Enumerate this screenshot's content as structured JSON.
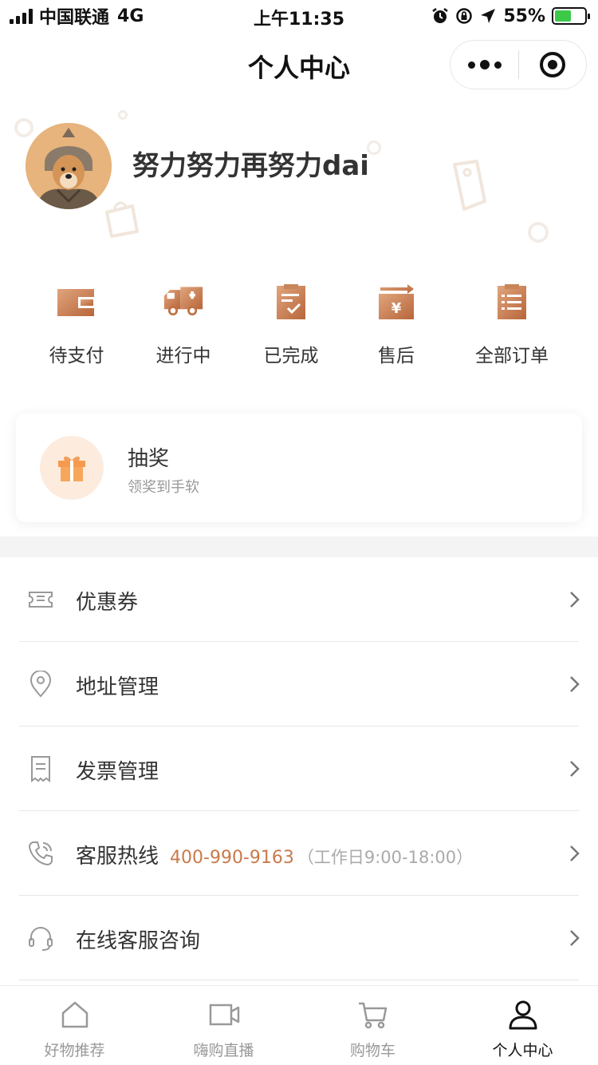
{
  "status_bar": {
    "carrier": "中国联通",
    "network": "4G",
    "time": "上午11:35",
    "battery": "55%",
    "battery_level": 0.55,
    "icons": [
      "signal-icon",
      "alarm-icon",
      "rotation-lock-icon",
      "location-arrow-icon",
      "battery-icon"
    ]
  },
  "nav": {
    "title": "个人中心",
    "capsule_icons": [
      "more-dots-icon",
      "close-target-icon"
    ]
  },
  "profile": {
    "username": "努力努力再努力dai",
    "avatar_icon": "dog-avatar"
  },
  "orders": [
    {
      "label": "待支付",
      "icon": "wallet-icon"
    },
    {
      "label": "进行中",
      "icon": "delivery-truck-icon"
    },
    {
      "label": "已完成",
      "icon": "clipboard-check-icon"
    },
    {
      "label": "售后",
      "icon": "yen-box-icon"
    },
    {
      "label": "全部订单",
      "icon": "clipboard-list-icon"
    }
  ],
  "lottery": {
    "title": "抽奖",
    "subtitle": "领奖到手软",
    "icon": "gift-icon"
  },
  "menu": [
    {
      "label": "优惠券",
      "icon": "coupon-icon"
    },
    {
      "label": "地址管理",
      "icon": "location-pin-icon"
    },
    {
      "label": "发票管理",
      "icon": "invoice-icon"
    },
    {
      "label": "客服热线",
      "icon": "phone-icon",
      "phone": "400-990-9163",
      "hours": "（工作日9:00-18:00）"
    },
    {
      "label": "在线客服咨询",
      "icon": "headset-icon"
    }
  ],
  "tabs": [
    {
      "label": "好物推荐",
      "icon": "home-icon",
      "active": false
    },
    {
      "label": "嗨购直播",
      "icon": "video-camera-icon",
      "active": false
    },
    {
      "label": "购物车",
      "icon": "cart-icon",
      "active": false
    },
    {
      "label": "个人中心",
      "icon": "person-icon",
      "active": true
    }
  ],
  "colors": {
    "accent": "#c87a4c",
    "icon_gradient_start": "#e0a57d",
    "icon_gradient_end": "#b8653a",
    "gift_bg": "#fdecde",
    "text_primary": "#333333",
    "text_secondary": "#999999",
    "battery_green": "#3cc94a"
  }
}
